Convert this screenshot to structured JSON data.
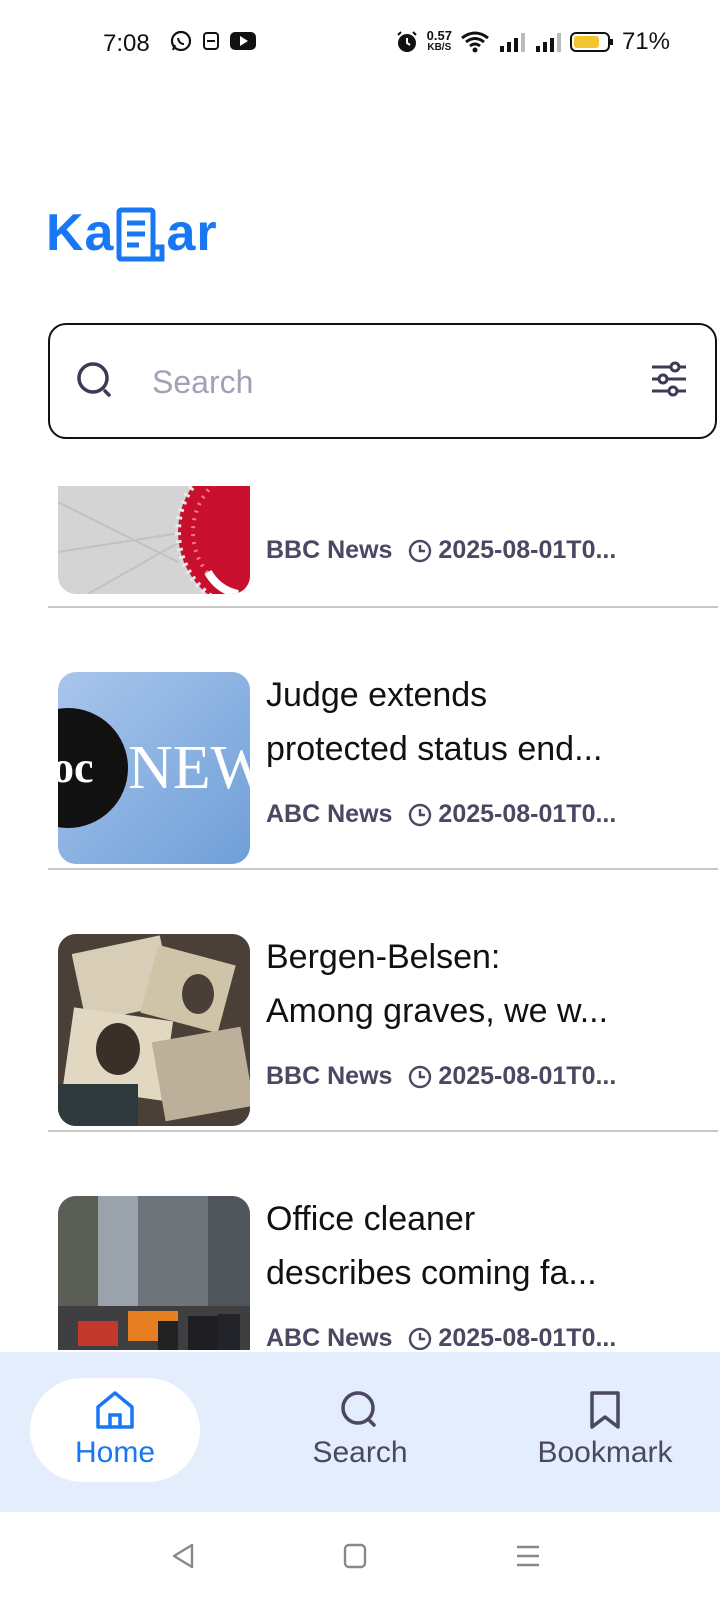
{
  "status_bar": {
    "time": "7:08",
    "net_speed": "0.57",
    "net_unit": "KB/S",
    "battery_percent": "71%"
  },
  "app": {
    "logo_text_left": "Ka",
    "logo_text_right": "ar",
    "brand_color": "#1877f2"
  },
  "search": {
    "placeholder": "Search"
  },
  "articles": [
    {
      "title_line1": "",
      "title_line2": "",
      "source": "BBC News",
      "date": "2025-08-01T0..."
    },
    {
      "title_line1": "Judge extends",
      "title_line2": "protected status end...",
      "source": "ABC News",
      "date": "2025-08-01T0..."
    },
    {
      "title_line1": "Bergen-Belsen:",
      "title_line2": "Among graves, we w...",
      "source": "BBC News",
      "date": "2025-08-01T0..."
    },
    {
      "title_line1": "Office cleaner",
      "title_line2": "describes coming fa...",
      "source": "ABC News",
      "date": "2025-08-01T0..."
    }
  ],
  "bottom_nav": {
    "home": "Home",
    "search": "Search",
    "bookmark": "Bookmark",
    "active": "home"
  },
  "icons": {
    "search": "search-icon",
    "filter": "filter-icon",
    "clock": "clock-icon",
    "home": "home-icon",
    "bookmark": "bookmark-icon"
  }
}
